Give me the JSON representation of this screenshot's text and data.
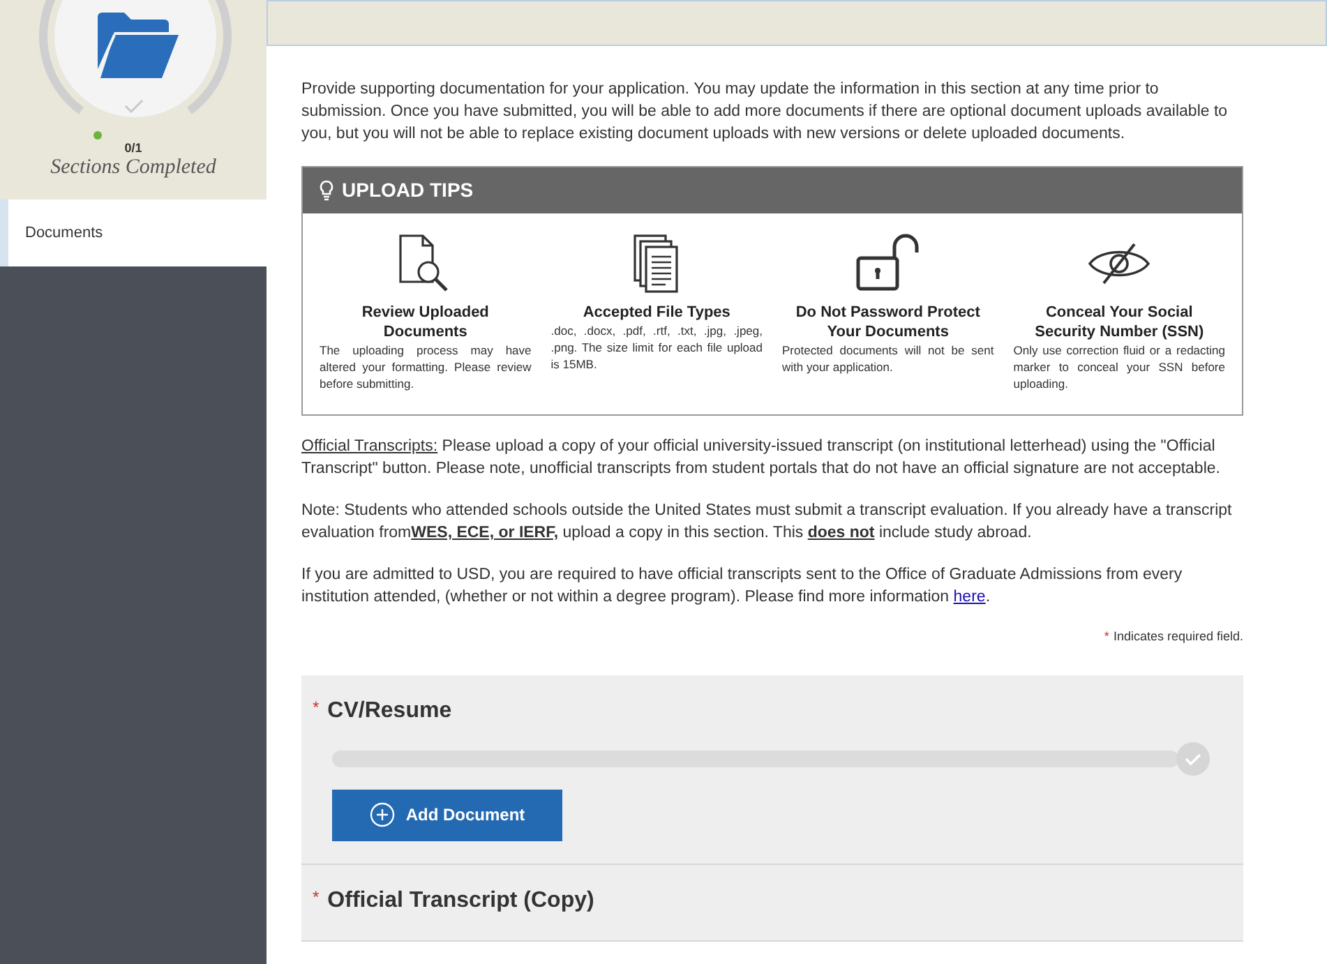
{
  "sidebar": {
    "progress": {
      "count": "0/1",
      "caption": "Sections Completed"
    },
    "items": [
      {
        "label": "Documents",
        "selected": true
      }
    ]
  },
  "intro": "Provide supporting documentation for your application. You may update the information in this section at any time prior to submission. Once you have submitted, you will be able to add more documents if there are optional document uploads available to you, but you will not be able to replace existing document uploads with new versions or delete uploaded documents.",
  "upload_tips": {
    "title": "UPLOAD TIPS",
    "tips": [
      {
        "kind": "review",
        "title": "Review Uploaded Documents",
        "text": "The uploading process may have altered your formatting. Please review before submitting."
      },
      {
        "kind": "files",
        "title": "Accepted File Types",
        "text": ".doc, .docx, .pdf, .rtf, .txt, .jpg, .jpeg, .png. The size limit for each file upload is 15MB."
      },
      {
        "kind": "lock",
        "title": "Do Not Password Protect Your Documents",
        "text": "Protected documents will not be sent with your application."
      },
      {
        "kind": "eye",
        "title": "Conceal Your Social Security Number (SSN)",
        "text": "Only use correction fluid or a redacting marker to conceal your SSN before uploading."
      }
    ]
  },
  "notes": [
    [
      {
        "kind": "label",
        "text": "Official Transcripts:"
      },
      {
        "kind": "text",
        "text": " Please upload a copy of your official university-issued transcript (on institutional letterhead) using the \"Official Transcript\" button. Please note, unofficial transcripts from student portals that do not have an official signature are not acceptable."
      }
    ],
    [
      {
        "kind": "text",
        "text": "Note: Students who attended schools outside the United States must submit a transcript evaluation. If you already have a transcript evaluation from"
      },
      {
        "kind": "emphasis",
        "text": "WES, ECE, or IERF,"
      },
      {
        "kind": "text",
        "text": " upload a copy in this section. This "
      },
      {
        "kind": "emphasis",
        "text": "does not"
      },
      {
        "kind": "text",
        "text": " include study abroad."
      }
    ],
    [
      {
        "kind": "text",
        "text": "If you are admitted to USD, you are required to have official transcripts sent to the Office of Graduate Admissions from every institution attended, (whether or not within a degree program). Please find more information "
      },
      {
        "kind": "link",
        "text": "here"
      },
      {
        "kind": "text",
        "text": "."
      }
    ]
  ],
  "required_note": {
    "mark": "*",
    "text": "Indicates required field."
  },
  "uploads": [
    {
      "mark": "*",
      "title": "CV/Resume",
      "button": "Add Document"
    },
    {
      "mark": "*",
      "title": "Official Transcript (Copy)"
    }
  ]
}
